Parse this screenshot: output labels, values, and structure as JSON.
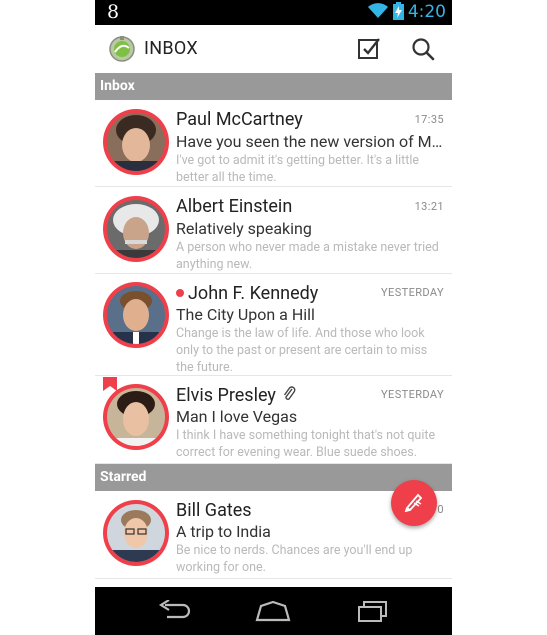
{
  "status_bar": {
    "left_text": "8",
    "time": "4:20"
  },
  "action_bar": {
    "title": "INBOX"
  },
  "sections": {
    "inbox": "Inbox",
    "starred": "Starred"
  },
  "inbox_items": [
    {
      "name": "Paul McCartney",
      "subject": "Have you seen the new version of Mi…",
      "preview": "I've got to admit it's getting better. It's a little better all the time.",
      "time": "17:35",
      "unread": false,
      "attachment": false,
      "bookmarked": false
    },
    {
      "name": "Albert Einstein",
      "subject": "Relatively speaking",
      "preview": "A person who never made a mistake never tried anything new.",
      "time": "13:21",
      "unread": false,
      "attachment": false,
      "bookmarked": false
    },
    {
      "name": "John F. Kennedy",
      "subject": "The City Upon a Hill",
      "preview": "Change is the law of life. And those who look only to the past or present are certain to miss the future.",
      "time": "YESTERDAY",
      "unread": true,
      "attachment": false,
      "bookmarked": false
    },
    {
      "name": "Elvis Presley",
      "subject": "Man I love Vegas",
      "preview": "I think I have something tonight that's not quite correct for evening wear. Blue suede shoes.",
      "time": "YESTERDAY",
      "unread": false,
      "attachment": true,
      "bookmarked": true
    }
  ],
  "starred_items": [
    {
      "name": "Bill Gates",
      "subject": "A trip to India",
      "preview": "Be nice to nerds. Chances are you'll end up working for one.",
      "time": "10"
    }
  ],
  "icons": {
    "wifi": "wifi-icon",
    "battery": "battery-charging-icon",
    "logo": "app-logo-icon",
    "select_all": "checkbox-icon",
    "search": "search-icon",
    "compose": "compose-pen-icon",
    "back": "back-icon",
    "home": "home-icon",
    "recents": "recent-apps-icon"
  },
  "colors": {
    "accent": "#ef3f4a",
    "status_time": "#33b5e5",
    "section_header": "#999999"
  }
}
